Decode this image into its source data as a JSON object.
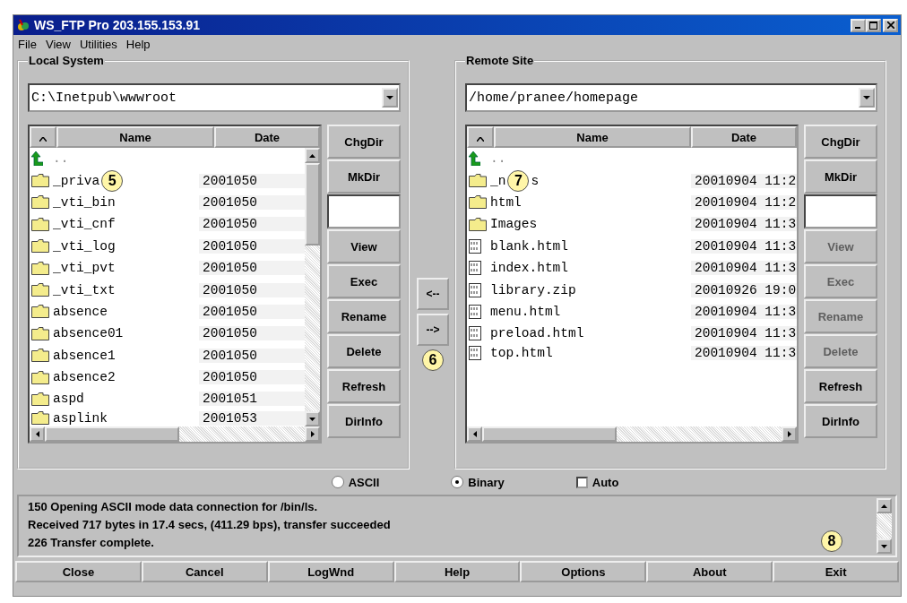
{
  "window": {
    "title": "WS_FTP Pro 203.155.153.91"
  },
  "menu": [
    {
      "label": "File"
    },
    {
      "label": "View"
    },
    {
      "label": "Utilities"
    },
    {
      "label": "Help"
    }
  ],
  "panes": [
    {
      "title": "Local System",
      "path": "C:\\Inetpub\\wwwroot",
      "columns": [
        "Name",
        "Date"
      ],
      "vscroll": true,
      "rows": [
        {
          "kind": "parent",
          "name": ".."
        },
        {
          "kind": "folder",
          "name": "_priva",
          "date": "2001050",
          "callout": "5"
        },
        {
          "kind": "folder",
          "name": "_vti_bin",
          "date": "2001050"
        },
        {
          "kind": "folder",
          "name": "_vti_cnf",
          "date": "2001050"
        },
        {
          "kind": "folder",
          "name": "_vti_log",
          "date": "2001050"
        },
        {
          "kind": "folder",
          "name": "_vti_pvt",
          "date": "2001050"
        },
        {
          "kind": "folder",
          "name": "_vti_txt",
          "date": "2001050"
        },
        {
          "kind": "folder",
          "name": "absence",
          "date": "2001050"
        },
        {
          "kind": "folder",
          "name": "absence01",
          "date": "2001050"
        },
        {
          "kind": "folder",
          "name": "absence1",
          "date": "2001050"
        },
        {
          "kind": "folder",
          "name": "absence2",
          "date": "2001050"
        },
        {
          "kind": "folder",
          "name": "aspd",
          "date": "2001051"
        },
        {
          "kind": "folder",
          "name": "asplink",
          "date": "2001053"
        }
      ],
      "buttons": [
        {
          "label": "ChgDir",
          "disabled": false
        },
        {
          "label": "MkDir",
          "disabled": false
        },
        {
          "kind": "field"
        },
        {
          "label": "View",
          "disabled": false
        },
        {
          "label": "Exec",
          "disabled": false
        },
        {
          "label": "Rename",
          "disabled": false
        },
        {
          "label": "Delete",
          "disabled": false
        },
        {
          "label": "Refresh",
          "disabled": false
        },
        {
          "label": "DirInfo",
          "disabled": false
        }
      ]
    },
    {
      "title": "Remote Site",
      "path": "/home/pranee/homepage",
      "columns": [
        "Name",
        "Date"
      ],
      "vscroll": false,
      "rows": [
        {
          "kind": "parent",
          "name": ".."
        },
        {
          "kind": "folder",
          "name": "_n",
          "date": "20010904 11:2",
          "callout": "7",
          "tail": "s"
        },
        {
          "kind": "folder",
          "name": "html",
          "date": "20010904 11:2"
        },
        {
          "kind": "folder",
          "name": "Images",
          "date": "20010904 11:3"
        },
        {
          "kind": "file",
          "name": "blank.html",
          "date": "20010904 11:3"
        },
        {
          "kind": "file",
          "name": "index.html",
          "date": "20010904 11:3"
        },
        {
          "kind": "file",
          "name": "library.zip",
          "date": "20010926 19:0"
        },
        {
          "kind": "file",
          "name": "menu.html",
          "date": "20010904 11:3"
        },
        {
          "kind": "file",
          "name": "preload.html",
          "date": "20010904 11:3"
        },
        {
          "kind": "file",
          "name": "top.html",
          "date": "20010904 11:3"
        }
      ],
      "buttons": [
        {
          "label": "ChgDir",
          "disabled": false
        },
        {
          "label": "MkDir",
          "disabled": false
        },
        {
          "kind": "field"
        },
        {
          "label": "View",
          "disabled": true
        },
        {
          "label": "Exec",
          "disabled": true
        },
        {
          "label": "Rename",
          "disabled": true
        },
        {
          "label": "Delete",
          "disabled": true
        },
        {
          "label": "Refresh",
          "disabled": false
        },
        {
          "label": "DirInfo",
          "disabled": false
        }
      ]
    }
  ],
  "transfer": {
    "buttons": [
      "<--",
      "-->"
    ],
    "callout": "6"
  },
  "mode": [
    {
      "kind": "radio",
      "label": "ASCII",
      "selected": false
    },
    {
      "kind": "radio",
      "label": "Binary",
      "selected": true
    },
    {
      "kind": "checkbox",
      "label": "Auto",
      "checked": false
    }
  ],
  "log": {
    "lines": [
      "150 Opening ASCII mode data connection for /bin/ls.",
      "Received 717 bytes in 17.4 secs, (411.29 bps), transfer succeeded",
      "226 Transfer complete."
    ],
    "callout": "8"
  },
  "bottom_buttons": [
    {
      "label": "Close"
    },
    {
      "label": "Cancel"
    },
    {
      "label": "LogWnd"
    },
    {
      "label": "Help"
    },
    {
      "label": "Options"
    },
    {
      "label": "About"
    },
    {
      "label": "Exit"
    }
  ]
}
